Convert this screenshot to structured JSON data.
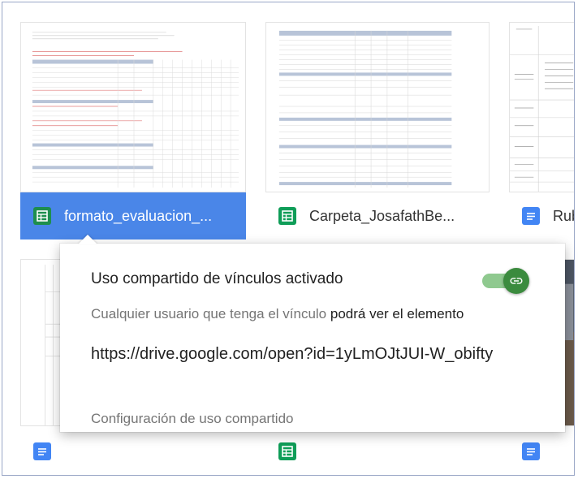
{
  "files_row1": [
    {
      "name": "formato_evaluacion_...",
      "type": "sheet",
      "selected": true
    },
    {
      "name": "Carpeta_JosafathBe...",
      "type": "sheet",
      "selected": false
    },
    {
      "name": "Rub",
      "type": "doc",
      "selected": false
    }
  ],
  "popup": {
    "title": "Uso compartido de vínculos activado",
    "desc_prefix": "Cualquier usuario que tenga el vínculo",
    "desc_suffix": "podrá ver el elemento",
    "link": "https://drive.google.com/open?id=1yLmOJtJUI-W_obifty",
    "settings_label": "Configuración de uso compartido",
    "toggle_on": true,
    "toggle_icon": "link-icon"
  },
  "colors": {
    "selected_bg": "#4a86e8",
    "sheet_green": "#0f9d58",
    "doc_blue": "#4285f4",
    "toggle_knob": "#3b8b3e"
  }
}
